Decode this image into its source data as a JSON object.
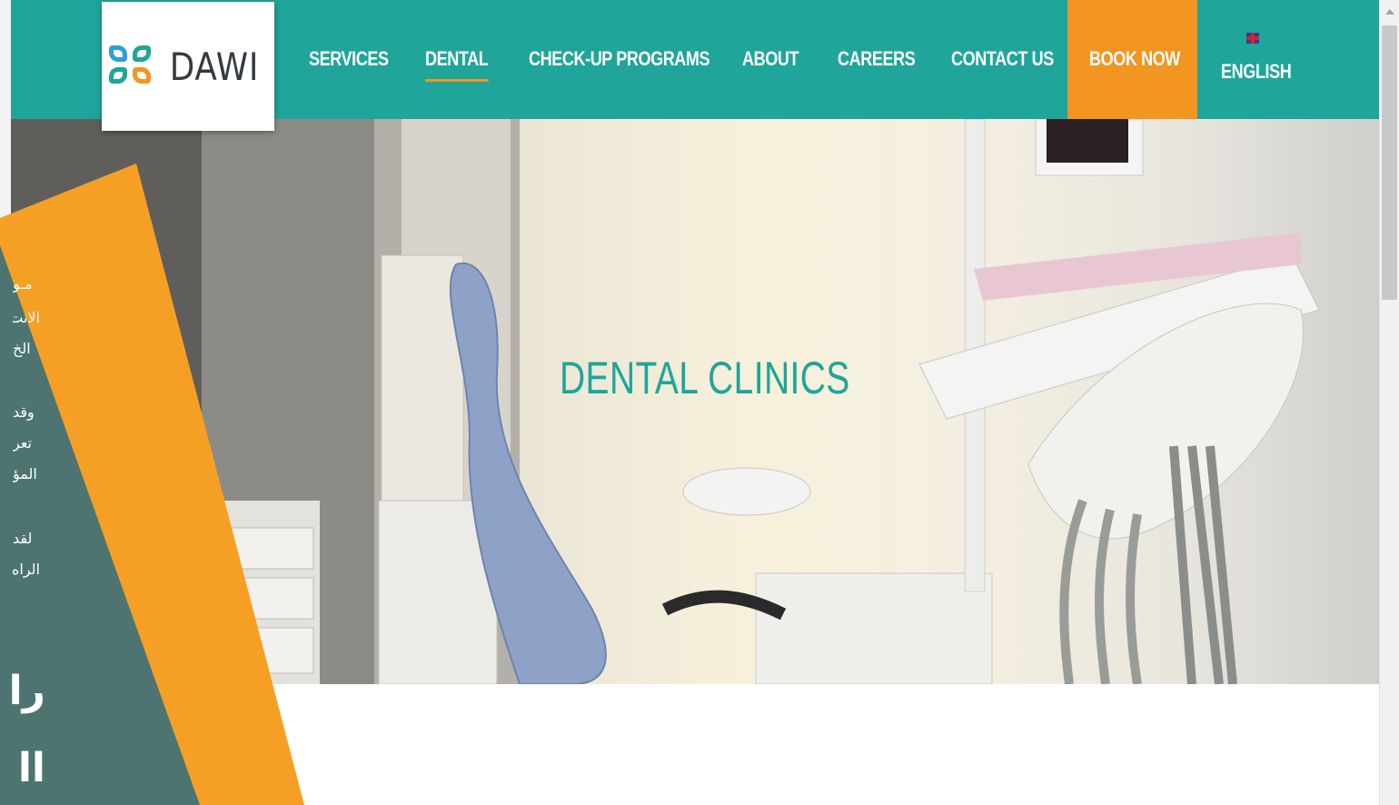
{
  "brand": {
    "logo_text": "DAWI",
    "colors": {
      "teal": "#1fa59a",
      "orange": "#f39521",
      "dark_teal": "#4d7470"
    }
  },
  "nav": {
    "items": [
      {
        "label": "SERVICES"
      },
      {
        "label": "DENTAL"
      },
      {
        "label": "CHECK-UP PROGRAMS"
      },
      {
        "label": "ABOUT"
      },
      {
        "label": "CAREERS"
      },
      {
        "label": "CONTACT US"
      }
    ],
    "active": "DENTAL",
    "book_label": "BOOK NOW",
    "language_label": "ENGLISH",
    "language_icon": "uk-flag-icon"
  },
  "hero": {
    "title": "DENTAL CLINICS"
  },
  "overlay": {
    "lines": [
      "مـو",
      "الانت",
      "الخ",
      "وقد",
      "تعر",
      "المؤ",
      "لقد",
      "الراه"
    ],
    "big_lines": [
      "را",
      "اا"
    ]
  }
}
